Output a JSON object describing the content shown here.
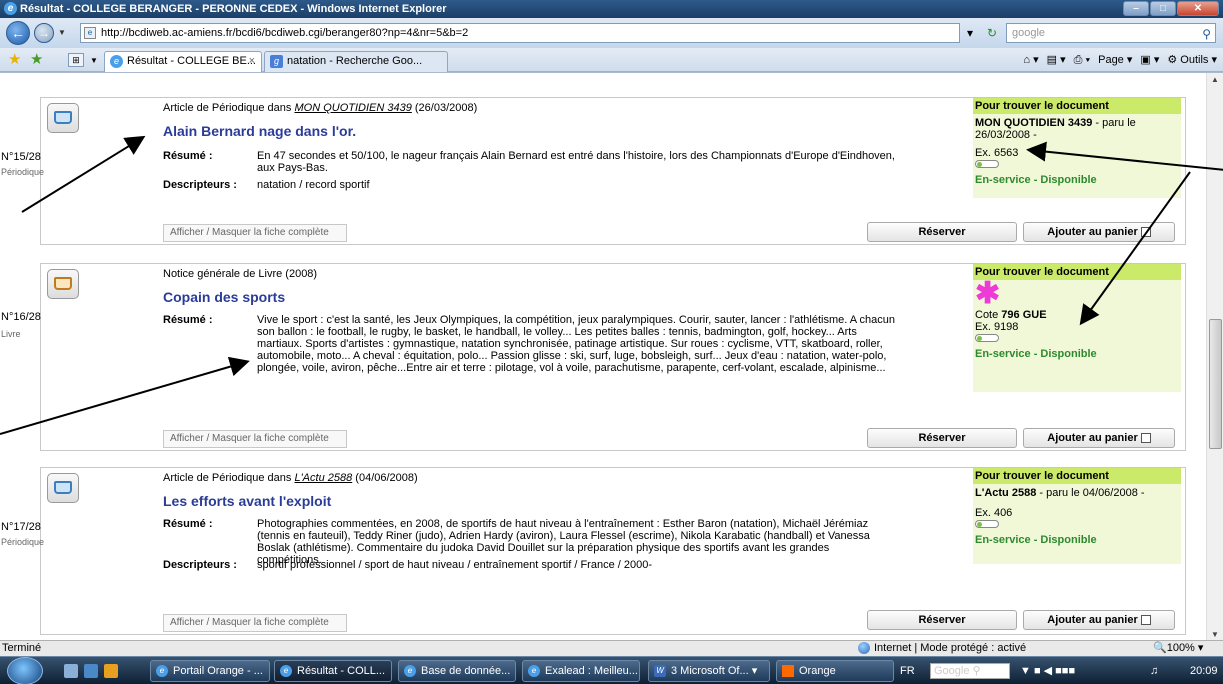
{
  "window": {
    "title": "Résultat - COLLEGE BERANGER - PERONNE CEDEX - Windows Internet Explorer",
    "url": "http://bcdiweb.ac-amiens.fr/bcdi6/bcdiweb.cgi/beranger80?np=4&nr=5&b=2",
    "search_placeholder": "google"
  },
  "tabs": [
    {
      "label": "Résultat - COLLEGE BE...",
      "active": true
    },
    {
      "label": "natation - Recherche Goo...",
      "active": false
    }
  ],
  "commands": {
    "page": "Page",
    "outils": "Outils"
  },
  "records": [
    {
      "num": "N°15/28",
      "type": "Périodique",
      "header_prefix": "Article de Périodique dans ",
      "header_link": "MON QUOTIDIEN 3439",
      "header_suffix": " (26/03/2008)",
      "title": "Alain Bernard nage dans l'or.",
      "resume_label": "Résumé :",
      "resume": "En 47 secondes et 50/100, le nageur français Alain Bernard est entré dans l'histoire, lors des Championnats d'Europe d'Eindhoven, aux Pays-Bas.",
      "desc_label": "Descripteurs :",
      "desc": "natation / record sportif",
      "toggle_label": "Afficher / Masquer la fiche complète",
      "reserve_label": "Réserver",
      "cart_label": "Ajouter au panier",
      "panel_title": "Pour trouver le document",
      "panel_source_bold": "MON QUOTIDIEN 3439",
      "panel_source_rest": " - paru le 26/03/2008 -",
      "panel_cote": "",
      "panel_ex": "Ex. 6563",
      "panel_status": "En-service - Disponible"
    },
    {
      "num": "N°16/28",
      "type": "Livre",
      "header_prefix": "Notice générale de Livre (2008)",
      "header_link": "",
      "header_suffix": "",
      "title": "Copain des sports",
      "resume_label": "Résumé :",
      "resume": "Vive le sport : c'est la santé, les Jeux Olympiques, la compétition, jeux paralympiques. Courir, sauter, lancer : l'athlétisme. A chacun son ballon : le football, le rugby, le basket, le handball, le volley... Les petites balles : tennis, badmington, golf, hockey... Arts martiaux. Sports d'artistes : gymnastique, natation synchronisée, patinage artistique. Sur roues : cyclisme, VTT, skatboard, roller, automobile, moto... A cheval : équitation, polo... Passion glisse : ski, surf, luge, bobsleigh, surf... Jeux d'eau : natation, water-polo, plongée, voile, aviron, pêche...Entre air et terre : pilotage, vol à voile, parachutisme, parapente, cerf-volant, escalade, alpinisme...",
      "desc_label": "",
      "desc": "",
      "toggle_label": "Afficher / Masquer la fiche complète",
      "reserve_label": "Réserver",
      "cart_label": "Ajouter au panier",
      "panel_title": "Pour trouver le document",
      "panel_cote_prefix": "Cote ",
      "panel_cote": "796 GUE",
      "panel_ex": "Ex. 9198",
      "panel_status": "En-service - Disponible"
    },
    {
      "num": "N°17/28",
      "type": "Périodique",
      "header_prefix": "Article de Périodique dans ",
      "header_link": "L'Actu 2588",
      "header_suffix": " (04/06/2008)",
      "title": "Les efforts avant l'exploit",
      "resume_label": "Résumé :",
      "resume": "Photographies commentées, en 2008, de sportifs de haut niveau à l'entraînement : Esther Baron (natation), Michaël Jérémiaz (tennis en fauteuil), Teddy Riner (judo), Adrien Hardy (aviron), Laura Flessel (escrime), Nikola Karabatic (handball) et Vanessa Boslak (athlétisme). Commentaire du judoka David Douillet sur la préparation physique des sportifs avant les grandes compétitions.",
      "desc_label": "Descripteurs :",
      "desc": "sportif professionnel / sport de haut niveau / entraînement sportif / France / 2000-",
      "toggle_label": "Afficher / Masquer la fiche complète",
      "reserve_label": "Réserver",
      "cart_label": "Ajouter au panier",
      "panel_title": "Pour trouver le document",
      "panel_source_bold": "L'Actu 2588",
      "panel_source_rest": " - paru le 04/06/2008 -",
      "panel_cote": "",
      "panel_ex": "Ex. 406",
      "panel_status": "En-service - Disponible"
    }
  ],
  "status": {
    "left": "Terminé",
    "zone": "Internet | Mode protégé : activé",
    "zoom": "100%"
  },
  "taskbar": {
    "buttons": [
      "Portail Orange - ...",
      "Résultat - COLL...",
      "Base de donnée...",
      "Exalead : Meilleu...",
      "3 Microsoft Of...",
      "Orange"
    ],
    "lang": "FR",
    "clock": "20:09"
  }
}
